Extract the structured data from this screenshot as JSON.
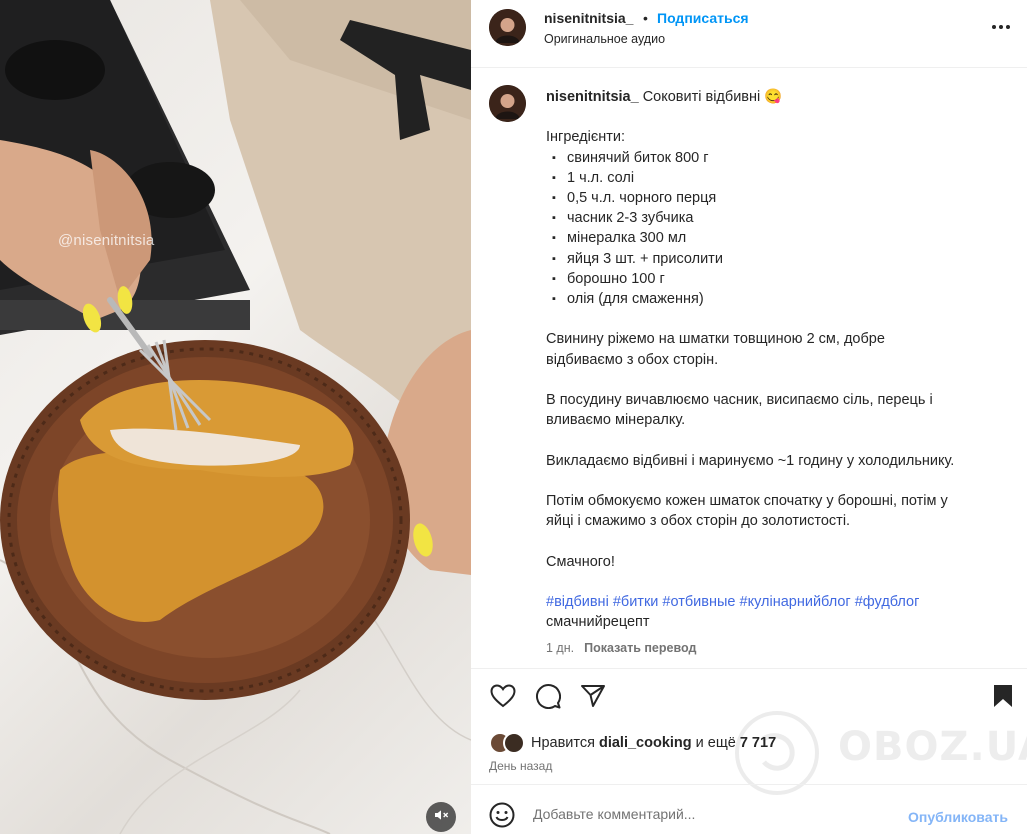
{
  "post": {
    "username": "nisenitnitsia_",
    "separator": "•",
    "follow_label": "Подписаться",
    "audio_label": "Оригинальное аудио",
    "more_icon": "more-horizontal-icon"
  },
  "media": {
    "watermark_handle": "@nisenitnitsia",
    "mute_icon": "speaker-muted-icon"
  },
  "caption": {
    "username": "nisenitnitsia_",
    "title": "Соковиті відбивні 😋",
    "ingredients_heading": "Інгредієнти:",
    "bullet": "▪",
    "ingredients": [
      "свинячий биток 800 г",
      "1 ч.л. солі",
      "0,5 ч.л. чорного перця",
      "часник 2-3 зубчика",
      "мінералка 300 мл",
      "яйця 3 шт. + присолити",
      "борошно 100 г",
      "олія (для смаження)"
    ],
    "paragraphs": [
      [
        "Свинину ріжемо на шматки товщиною 2 см, добре",
        "відбиваємо з обох сторін."
      ],
      [
        "В посудину вичавлюємо часник, висипаємо сіль, перець і",
        "вливаємо мінералку."
      ],
      [
        "Викладаємо відбивні і маринуємо ~1 годину у холодильнику."
      ],
      [
        "Потім обмокуємо кожен шматок спочатку у борошні, потім у",
        "яйці і смажимо з обох сторін до золотистості."
      ],
      [
        "Смачного!"
      ]
    ],
    "hashtags": [
      "#відбивні",
      "#битки",
      "#отбивные",
      "#кулінарнийблог",
      "#фудблог"
    ],
    "hashtag_tail": "смачнийрецепт",
    "age": "1 дн.",
    "translate_label": "Показать перевод"
  },
  "actions": {
    "like_icon": "heart-icon",
    "comment_icon": "comment-icon",
    "share_icon": "send-icon",
    "save_icon": "bookmark-icon",
    "likes_prefix": "Нравится",
    "liked_by": "diali_cooking",
    "likes_and": "и ещё",
    "likes_count": "7 717",
    "time_ago": "День назад"
  },
  "comment": {
    "emoji_icon": "emoji-icon",
    "placeholder": "Добавьте комментарий...",
    "post_label": "Опубликовать"
  },
  "watermark": {
    "brand": "OBOZ.UA"
  },
  "colors": {
    "accent": "#0095f6",
    "hashtag": "#4169e1",
    "post_disabled": "#84b5f7",
    "muted_text": "#737373"
  }
}
